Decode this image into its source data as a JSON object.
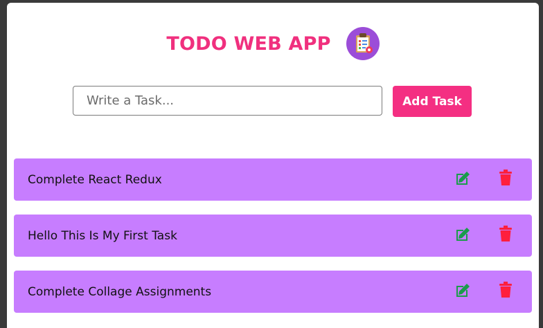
{
  "app": {
    "title": "TODO WEB APP",
    "logo_icon": "clipboard-checklist-icon"
  },
  "input": {
    "placeholder": "Write a Task...",
    "value": ""
  },
  "add_button": {
    "label": "Add Task"
  },
  "tasks": [
    {
      "text": "Complete React Redux"
    },
    {
      "text": "Hello This Is My First Task"
    },
    {
      "text": "Complete Collage Assignments"
    }
  ],
  "actions": {
    "edit_icon": "edit-icon",
    "delete_icon": "trash-icon"
  },
  "colors": {
    "accent": "#f42f82",
    "task_background": "#c77dff",
    "edit": "#1a9b4b",
    "delete": "#ff1f3d",
    "logo_background": "#9b4dd8"
  }
}
